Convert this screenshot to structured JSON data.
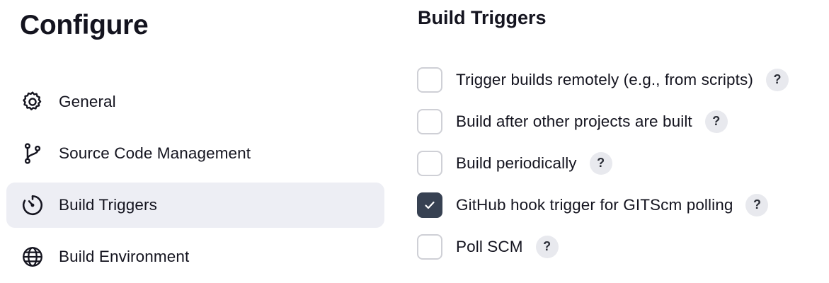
{
  "sidebar": {
    "title": "Configure",
    "items": [
      {
        "label": "General",
        "icon": "gear-icon",
        "active": false
      },
      {
        "label": "Source Code Management",
        "icon": "git-branch-icon",
        "active": false
      },
      {
        "label": "Build Triggers",
        "icon": "timer-icon",
        "active": true
      },
      {
        "label": "Build Environment",
        "icon": "globe-icon",
        "active": false
      }
    ]
  },
  "main": {
    "section_title": "Build Triggers",
    "help_glyph": "?",
    "triggers": [
      {
        "label": "Trigger builds remotely (e.g., from scripts)",
        "checked": false
      },
      {
        "label": "Build after other projects are built",
        "checked": false
      },
      {
        "label": "Build periodically",
        "checked": false
      },
      {
        "label": "GitHub hook trigger for GITScm polling",
        "checked": true
      },
      {
        "label": "Poll SCM",
        "checked": false
      }
    ]
  },
  "colors": {
    "active_nav_bg": "#edeef4",
    "checkbox_checked": "#374152",
    "checkbox_border": "#cfd0d6",
    "help_bg": "#e8e9ee"
  }
}
